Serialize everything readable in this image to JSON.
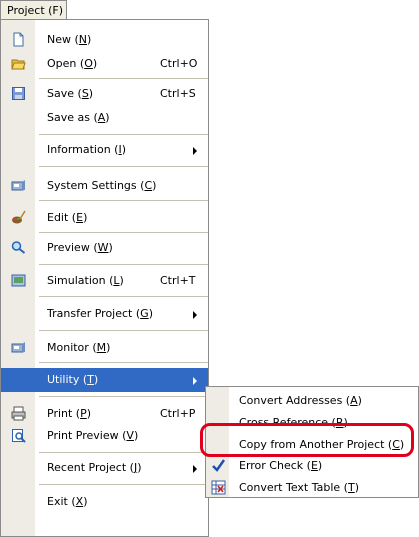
{
  "menubar": {
    "title": "Project (F)"
  },
  "menu": {
    "items": [
      {
        "label": "New",
        "mnemonic": "N",
        "shortcut": "",
        "icon": "new-document-icon"
      },
      {
        "label": "Open",
        "mnemonic": "O",
        "shortcut": "Ctrl+O",
        "icon": "open-folder-icon"
      },
      {
        "label": "Save",
        "mnemonic": "S",
        "shortcut": "Ctrl+S",
        "icon": "save-icon"
      },
      {
        "label": "Save as",
        "mnemonic": "A",
        "shortcut": ""
      },
      {
        "label": "Information",
        "mnemonic": "I",
        "shortcut": ""
      },
      {
        "label": "System Settings",
        "mnemonic": "C",
        "shortcut": "",
        "icon": "system-settings-icon"
      },
      {
        "label": "Edit",
        "mnemonic": "E",
        "shortcut": "",
        "icon": "edit-icon"
      },
      {
        "label": "Preview",
        "mnemonic": "W",
        "shortcut": "",
        "icon": "preview-icon"
      },
      {
        "label": "Simulation",
        "mnemonic": "L",
        "shortcut": "Ctrl+T",
        "icon": "simulation-icon"
      },
      {
        "label": "Transfer Project",
        "mnemonic": "G",
        "shortcut": ""
      },
      {
        "label": "Monitor",
        "mnemonic": "M",
        "shortcut": "",
        "icon": "monitor-icon"
      },
      {
        "label": "Utility",
        "mnemonic": "T",
        "shortcut": ""
      },
      {
        "label": "Print",
        "mnemonic": "P",
        "shortcut": "Ctrl+P",
        "icon": "print-icon"
      },
      {
        "label": "Print Preview",
        "mnemonic": "V",
        "shortcut": "",
        "icon": "print-preview-icon"
      },
      {
        "label": "Recent Project",
        "mnemonic": "J",
        "shortcut": ""
      },
      {
        "label": "Exit",
        "mnemonic": "X",
        "shortcut": ""
      }
    ]
  },
  "submenu": {
    "items": [
      {
        "label": "Convert Addresses",
        "mnemonic": "A"
      },
      {
        "label": "Cross Reference",
        "mnemonic": "R"
      },
      {
        "label": "Copy from Another Project",
        "mnemonic": "C"
      },
      {
        "label": "Error Check",
        "mnemonic": "E",
        "icon": "checkmark-icon"
      },
      {
        "label": "Convert Text Table",
        "mnemonic": "T",
        "icon": "convert-text-table-icon"
      }
    ]
  },
  "colors": {
    "highlight": "#316ac5",
    "callout": "#e0001b",
    "gutter": "#eeece4"
  }
}
